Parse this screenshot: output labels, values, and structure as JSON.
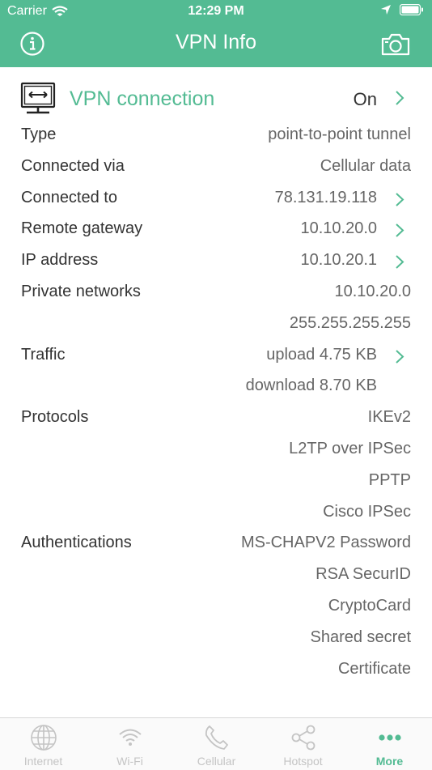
{
  "status_bar": {
    "carrier": "Carrier",
    "time": "12:29 PM"
  },
  "nav": {
    "title": "VPN Info",
    "left_icon": "info-icon",
    "right_icon": "camera-icon"
  },
  "colors": {
    "accent": "#53bb93",
    "text": "#333333",
    "value_text": "#666666",
    "tab_inactive": "#c4c4c4"
  },
  "vpn": {
    "title": "VPN connection",
    "status": "On"
  },
  "rows": [
    {
      "label": "Type",
      "value": "point-to-point tunnel",
      "link": false
    },
    {
      "label": "Connected via",
      "value": "Cellular data",
      "link": false
    },
    {
      "label": "Connected to",
      "value": "78.131.19.118",
      "link": true
    },
    {
      "label": "Remote gateway",
      "value": "10.10.20.0",
      "link": true
    },
    {
      "label": "IP address",
      "value": "10.10.20.1",
      "link": true
    },
    {
      "label": "Private networks",
      "value": "10.10.20.0",
      "link": false
    },
    {
      "label": "",
      "value": "255.255.255.255",
      "link": false
    },
    {
      "label": "Traffic",
      "value": "upload 4.75 KB",
      "link": true
    },
    {
      "label": "",
      "value": "download 8.70 KB",
      "link": false,
      "align_link": true
    },
    {
      "label": "Protocols",
      "value": "IKEv2",
      "link": false
    },
    {
      "label": "",
      "value": "L2TP over IPSec",
      "link": false
    },
    {
      "label": "",
      "value": "PPTP",
      "link": false
    },
    {
      "label": "",
      "value": "Cisco IPSec",
      "link": false
    },
    {
      "label": "Authentications",
      "value": "MS-CHAPV2 Password",
      "link": false
    },
    {
      "label": "",
      "value": "RSA SecurID",
      "link": false
    },
    {
      "label": "",
      "value": "CryptoCard",
      "link": false
    },
    {
      "label": "",
      "value": "Shared secret",
      "link": false
    },
    {
      "label": "",
      "value": "Certificate",
      "link": false
    }
  ],
  "tabs": [
    {
      "label": "Internet",
      "icon": "globe-icon",
      "active": false
    },
    {
      "label": "Wi-Fi",
      "icon": "wifi-icon",
      "active": false
    },
    {
      "label": "Cellular",
      "icon": "phone-icon",
      "active": false
    },
    {
      "label": "Hotspot",
      "icon": "share-icon",
      "active": false
    },
    {
      "label": "More",
      "icon": "more-icon",
      "active": true
    }
  ]
}
